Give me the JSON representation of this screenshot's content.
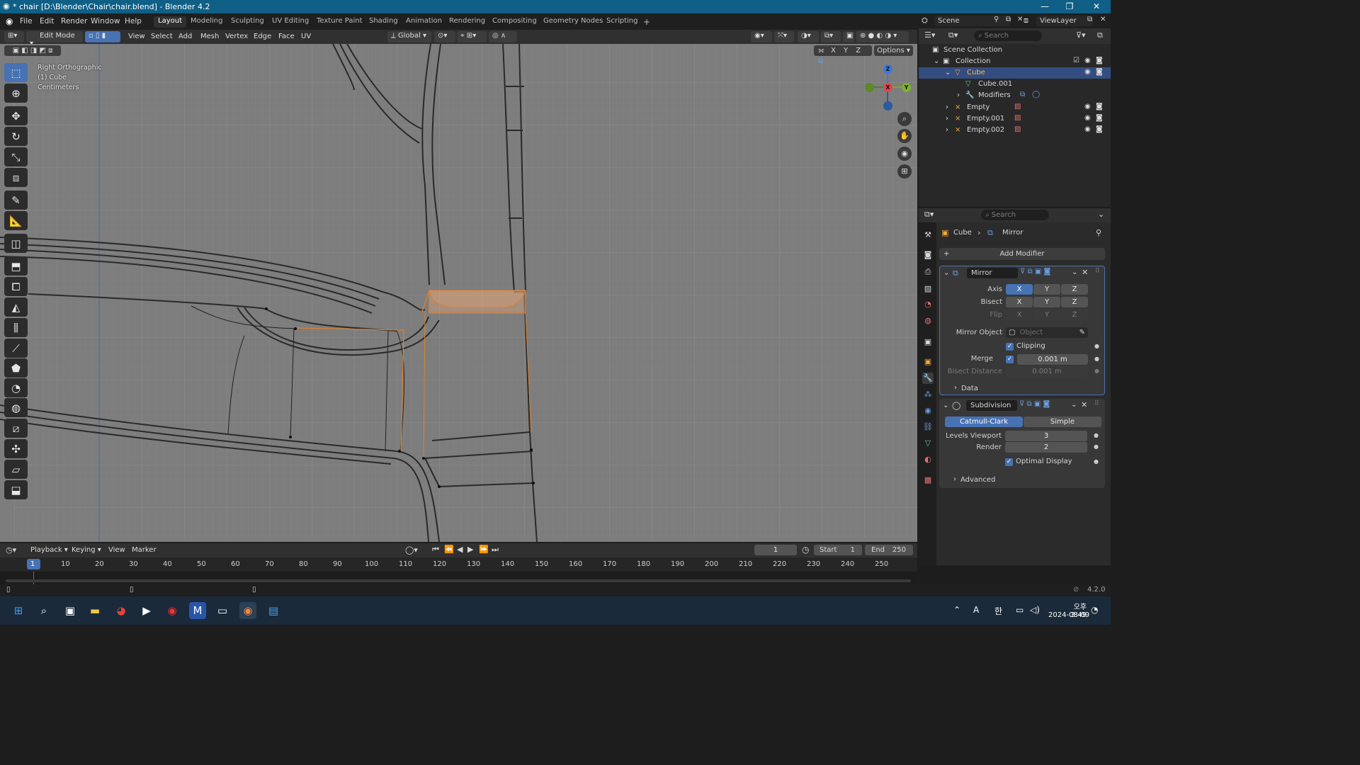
{
  "window": {
    "title": "* chair [D:\\Blender\\Chair\\chair.blend] - Blender 4.2",
    "minimize": "—",
    "maximize": "❐",
    "close": "✕"
  },
  "menu": {
    "items": [
      "File",
      "Edit",
      "Render",
      "Window",
      "Help"
    ],
    "workspaces": [
      "Layout",
      "Modeling",
      "Sculpting",
      "UV Editing",
      "Texture Paint",
      "Shading",
      "Animation",
      "Rendering",
      "Compositing",
      "Geometry Nodes",
      "Scripting"
    ],
    "active_workspace": "Layout",
    "add_workspace": "+",
    "scene_label": "Scene",
    "viewlayer_label": "ViewLayer"
  },
  "viewport_header": {
    "mode": "Edit Mode",
    "menus": [
      "View",
      "Select",
      "Add",
      "Mesh",
      "Vertex",
      "Edge",
      "Face",
      "UV"
    ],
    "orientation": "Global",
    "options": "Options",
    "axis_x": "X",
    "axis_y": "Y",
    "axis_z": "Z"
  },
  "viewport": {
    "view_name": "Right Orthographic",
    "object_line": "(1) Cube",
    "units": "Centimeters",
    "gizmo": {
      "z": "Z",
      "x": "X",
      "y": "Y"
    }
  },
  "toolbar": {
    "tools": [
      "select-box",
      "cursor",
      "move",
      "rotate",
      "scale",
      "transform",
      "annotate",
      "measure",
      "add-cube",
      "extrude",
      "inset",
      "bevel",
      "loop-cut",
      "knife",
      "poly-build",
      "spin",
      "smooth",
      "edge-slide",
      "shrink-fatten",
      "shear",
      "rip-region"
    ]
  },
  "outliner": {
    "search_placeholder": "Search",
    "rows": [
      {
        "label": "Scene Collection",
        "indent": 0
      },
      {
        "label": "Collection",
        "indent": 1
      },
      {
        "label": "Cube",
        "indent": 2,
        "selected": true
      },
      {
        "label": "Cube.001",
        "indent": 3
      },
      {
        "label": "Modifiers",
        "indent": 3
      },
      {
        "label": "Empty",
        "indent": 2
      },
      {
        "label": "Empty.001",
        "indent": 2
      },
      {
        "label": "Empty.002",
        "indent": 2
      }
    ]
  },
  "properties": {
    "search_placeholder": "Search",
    "breadcrumb_object": "Cube",
    "breadcrumb_modifier": "Mirror",
    "add_modifier": "Add Modifier",
    "mirror": {
      "name": "Mirror",
      "axis_label": "Axis",
      "bisect_label": "Bisect",
      "flip_label": "Flip",
      "x": "X",
      "y": "Y",
      "z": "Z",
      "mirror_object_label": "Mirror Object",
      "mirror_object_placeholder": "Object",
      "clipping_label": "Clipping",
      "merge_label": "Merge",
      "merge_value": "0.001 m",
      "bisect_distance_label": "Bisect Distance",
      "bisect_distance_value": "0.001 m",
      "data_label": "Data"
    },
    "subdivision": {
      "name": "Subdivision",
      "catmull": "Catmull-Clark",
      "simple": "Simple",
      "levels_viewport_label": "Levels Viewport",
      "levels_viewport_value": "3",
      "render_label": "Render",
      "render_value": "2",
      "optimal_display_label": "Optimal Display",
      "advanced_label": "Advanced"
    }
  },
  "timeline": {
    "menus": [
      "Playback",
      "Keying",
      "View",
      "Marker"
    ],
    "current_frame": "1",
    "start_label": "Start",
    "start_value": "1",
    "end_label": "End",
    "end_value": "250",
    "ruler": [
      "1",
      "10",
      "20",
      "30",
      "40",
      "50",
      "60",
      "70",
      "80",
      "90",
      "100",
      "110",
      "120",
      "130",
      "140",
      "150",
      "160",
      "170",
      "180",
      "190",
      "200",
      "210",
      "220",
      "230",
      "240",
      "250"
    ]
  },
  "statusbar": {
    "version": "4.2.0"
  },
  "taskbar": {
    "time": "오후 3:49",
    "date": "2024-08-09",
    "ime": "A",
    "ime2": "한"
  }
}
